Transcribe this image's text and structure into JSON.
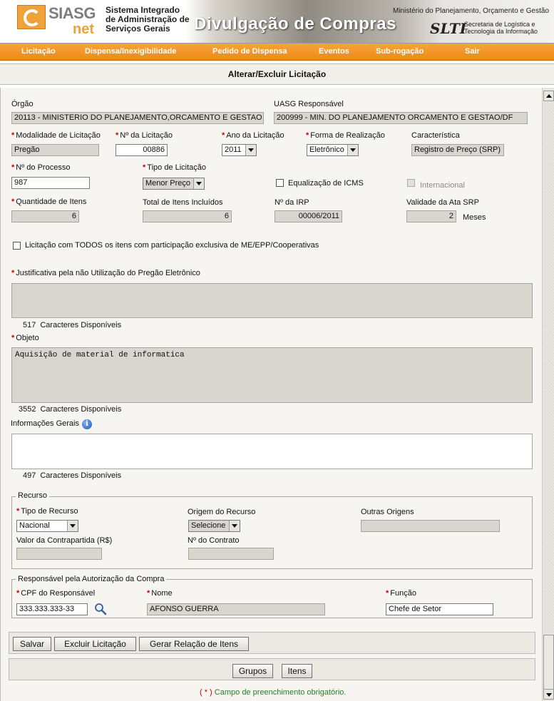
{
  "header": {
    "logo_siasg": "SIASG",
    "logo_net": "net",
    "system_title": "Sistema Integrado de Administração de Serviços Gerais",
    "banner_title": "Divulgação de Compras",
    "ministry": "Ministério do Planejamento, Orçamento e Gestão",
    "slti_logo": "SLTI",
    "secretaria": "Secretaria de Logística e Tecnologia da Informação"
  },
  "menu": {
    "items": [
      "Licitação",
      "Dispensa/Inexigibilidade",
      "Pedido de Dispensa",
      "Eventos",
      "Sub-rogação",
      "Sair"
    ]
  },
  "page_title": "Alterar/Excluir Licitação",
  "form": {
    "orgao": {
      "label": "Órgão",
      "value": "20113 - MINISTERIO DO PLANEJAMENTO,ORCAMENTO E GESTAO"
    },
    "uasg": {
      "label": "UASG Responsável",
      "value": "200999 - MIN. DO PLANEJAMENTO ORCAMENTO E GESTAO/DF"
    },
    "modalidade": {
      "label": "Modalidade de Licitação",
      "value": "Pregão"
    },
    "numero_licitacao": {
      "label": "Nº da Licitação",
      "value": "00886"
    },
    "ano_licitacao": {
      "label": "Ano da Licitação",
      "value": "2011"
    },
    "forma_realizacao": {
      "label": "Forma de Realização",
      "value": "Eletrônico"
    },
    "caracteristica": {
      "label": "Característica",
      "value": "Registro de Preço (SRP)"
    },
    "numero_processo": {
      "label": "Nº do Processo",
      "value": "987"
    },
    "tipo_licitacao": {
      "label": "Tipo de Licitação",
      "value": "Menor Preço"
    },
    "equalizacao_icms": {
      "label": "Equalização de ICMS",
      "checked": false
    },
    "internacional": {
      "label": "Internacional",
      "checked": false
    },
    "quantidade_itens": {
      "label": "Quantidade de Itens",
      "value": "6"
    },
    "total_itens": {
      "label": "Total de Itens Incluídos",
      "value": "6"
    },
    "numero_irp": {
      "label": "Nº da IRP",
      "value": "00006/2011"
    },
    "validade_ata": {
      "label": "Validade da Ata SRP",
      "value": "2",
      "unit": "Meses"
    },
    "exclusiva_me": {
      "label": "Licitação com TODOS os itens com participação exclusiva de ME/EPP/Cooperativas",
      "checked": false
    },
    "justificativa": {
      "label": "Justificativa pela não Utilização do Pregão Eletrônico",
      "value": "",
      "remaining": "517",
      "remaining_label": "Caracteres Disponíveis"
    },
    "objeto": {
      "label": "Objeto",
      "value": "Aquisição de material de informatica",
      "remaining": "3552",
      "remaining_label": "Caracteres Disponíveis"
    },
    "informacoes_gerais": {
      "label": "Informações Gerais",
      "value": "",
      "remaining": "497",
      "remaining_label": "Caracteres Disponíveis"
    }
  },
  "recurso": {
    "legend": "Recurso",
    "tipo_recurso": {
      "label": "Tipo de Recurso",
      "value": "Nacional"
    },
    "origem_recurso": {
      "label": "Origem do Recurso",
      "value": "Selecione"
    },
    "outras_origens": {
      "label": "Outras Origens",
      "value": ""
    },
    "valor_contrapartida": {
      "label": "Valor da Contrapartida (R$)",
      "value": ""
    },
    "numero_contrato": {
      "label": "Nº do Contrato",
      "value": ""
    }
  },
  "responsavel": {
    "legend": "Responsável pela Autorização da Compra",
    "cpf": {
      "label": "CPF do Responsável",
      "value": "333.333.333-33"
    },
    "nome": {
      "label": "Nome",
      "value": "AFONSO GUERRA"
    },
    "funcao": {
      "label": "Função",
      "value": "Chefe de Setor"
    }
  },
  "buttons": {
    "salvar": "Salvar",
    "excluir": "Excluir Licitação",
    "gerar_relacao": "Gerar Relação de Itens",
    "grupos": "Grupos",
    "itens": "Itens"
  },
  "footer_note": {
    "star": "( * )",
    "text": "Campo de preenchimento obrigatório."
  },
  "required_mark": "*",
  "info_icon_glyph": "i",
  "colors": {
    "menu_orange": "#ee8a12",
    "readonly_gray": "#d8d6ce",
    "required_red": "#cc0000",
    "note_green": "#2a7a2a"
  }
}
